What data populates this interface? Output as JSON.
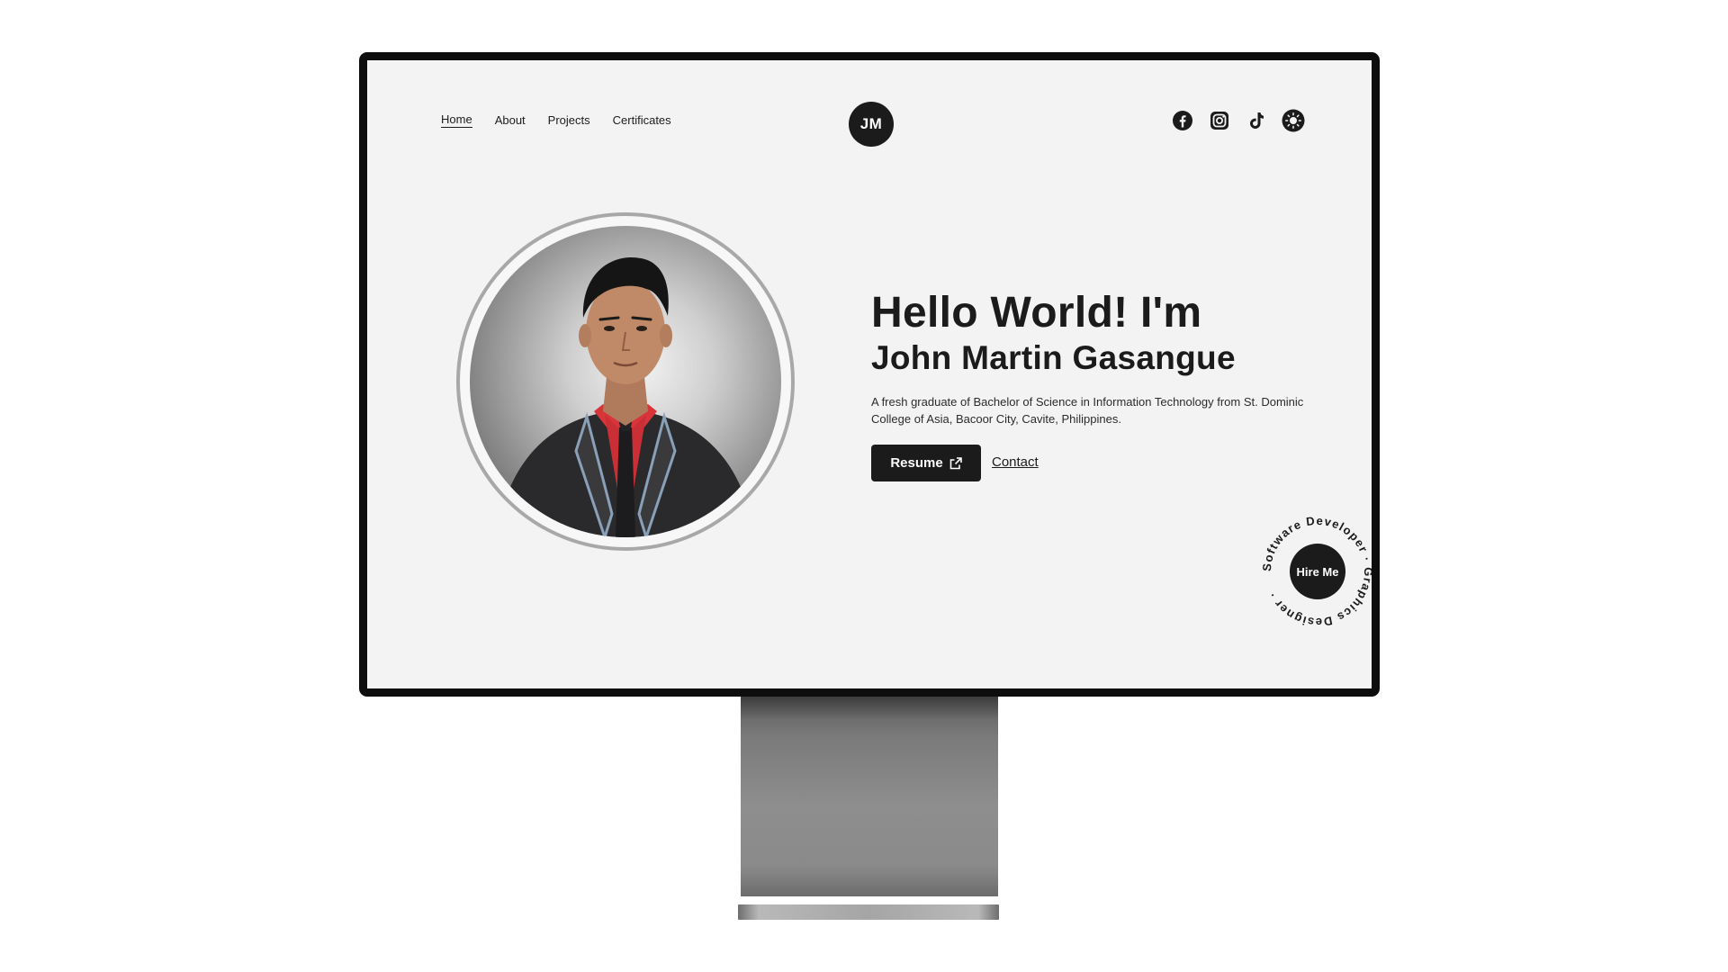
{
  "nav": {
    "items": [
      {
        "label": "Home",
        "active": true
      },
      {
        "label": "About",
        "active": false
      },
      {
        "label": "Projects",
        "active": false
      },
      {
        "label": "Certificates",
        "active": false
      }
    ]
  },
  "logo": {
    "text": "JM"
  },
  "socials": [
    {
      "icon": "facebook-icon"
    },
    {
      "icon": "instagram-icon"
    },
    {
      "icon": "tiktok-icon"
    },
    {
      "icon": "theme-toggle-sun-icon"
    }
  ],
  "hero": {
    "greeting": "Hello World! I'm",
    "name": "John Martin Gasangue",
    "description": "A fresh graduate of Bachelor of Science in Information Technology from St. Dominic College of Asia, Bacoor City, Cavite, Philippines.",
    "resume_label": "Resume",
    "contact_label": "Contact"
  },
  "hire": {
    "label": "Hire Me",
    "ring_text": "Software Developer · Graphics Designer · "
  },
  "colors": {
    "screen_bg": "#f3f3f3",
    "dark": "#1b1b1b",
    "bezel": "#0d0d0d"
  }
}
